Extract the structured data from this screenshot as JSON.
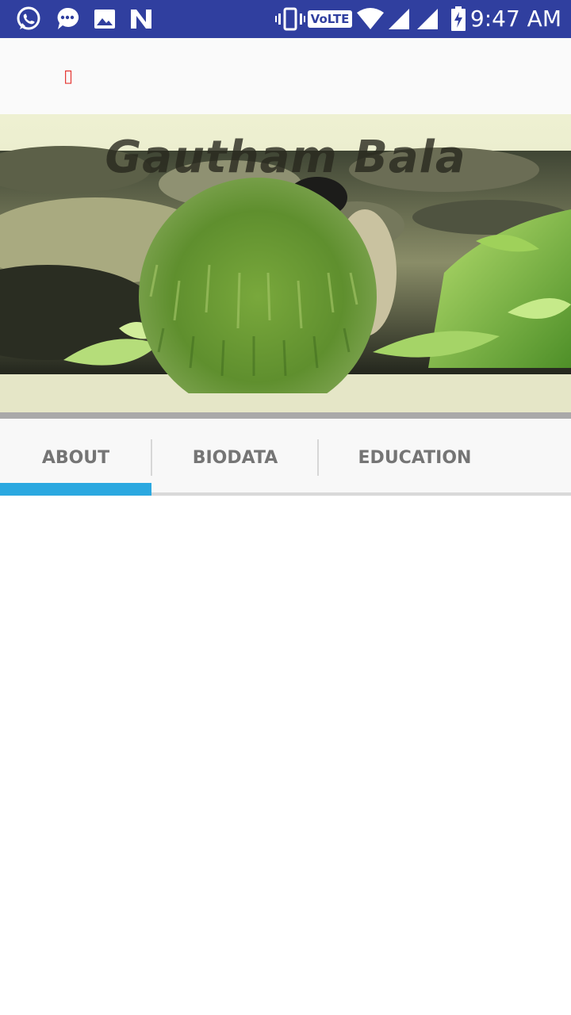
{
  "status_bar": {
    "time": "9:47 AM",
    "network_label": "VoLTE",
    "icons": [
      "whatsapp-icon",
      "messages-icon",
      "gallery-icon",
      "n-app-icon",
      "vibrate-icon",
      "volte-icon",
      "wifi-icon",
      "signal-icon",
      "signal-icon-2",
      "battery-charging-icon"
    ]
  },
  "toolbar": {
    "glyph": "▯"
  },
  "header": {
    "title": "Gautham Bala"
  },
  "tabs": [
    {
      "label": "ABOUT",
      "selected": true
    },
    {
      "label": "BIODATA",
      "selected": false
    },
    {
      "label": "EDUCATION",
      "selected": false
    }
  ],
  "colors": {
    "status_bar": "#303f9f",
    "tab_indicator": "#2ba8e0",
    "tab_text": "#757575"
  }
}
